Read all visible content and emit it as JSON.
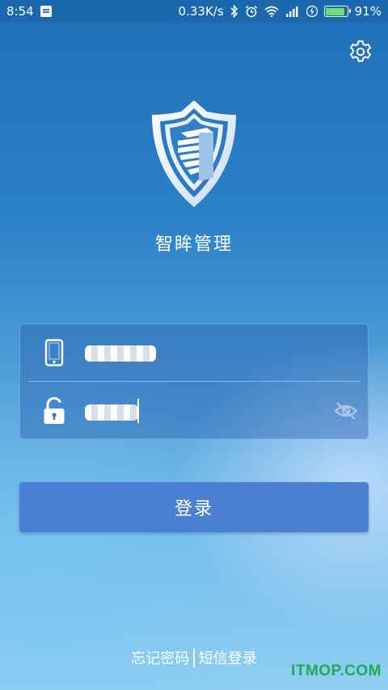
{
  "status_bar": {
    "time": "8:54",
    "net_speed": "0.33K/s",
    "battery_percent": "91%",
    "battery_level": 0.91,
    "icons": [
      "message-icon",
      "bluetooth-icon",
      "alarm-icon",
      "wifi-icon",
      "signal-icon",
      "charging-icon",
      "battery-icon"
    ]
  },
  "header": {
    "settings_icon": "gear-icon"
  },
  "app": {
    "title": "智眸管理",
    "logo": "shield-building-logo"
  },
  "login_form": {
    "username": {
      "icon": "phone-icon",
      "value_obscured": true
    },
    "password": {
      "icon": "unlock-icon",
      "value_obscured": true,
      "visibility_icon": "eye-off-icon"
    }
  },
  "login_button": {
    "label": "登录"
  },
  "links": {
    "forgot_password": "忘记密码",
    "sms_login": "短信登录"
  },
  "watermark": "ITMOP.COM",
  "colors": {
    "background_top": "#1f6fb8",
    "background_bottom": "#8fcff3",
    "button": "#4a7fd2",
    "card": "rgba(40,95,175,0.42)",
    "watermark": "#22aa55",
    "battery_fill": "#6fe06f"
  }
}
